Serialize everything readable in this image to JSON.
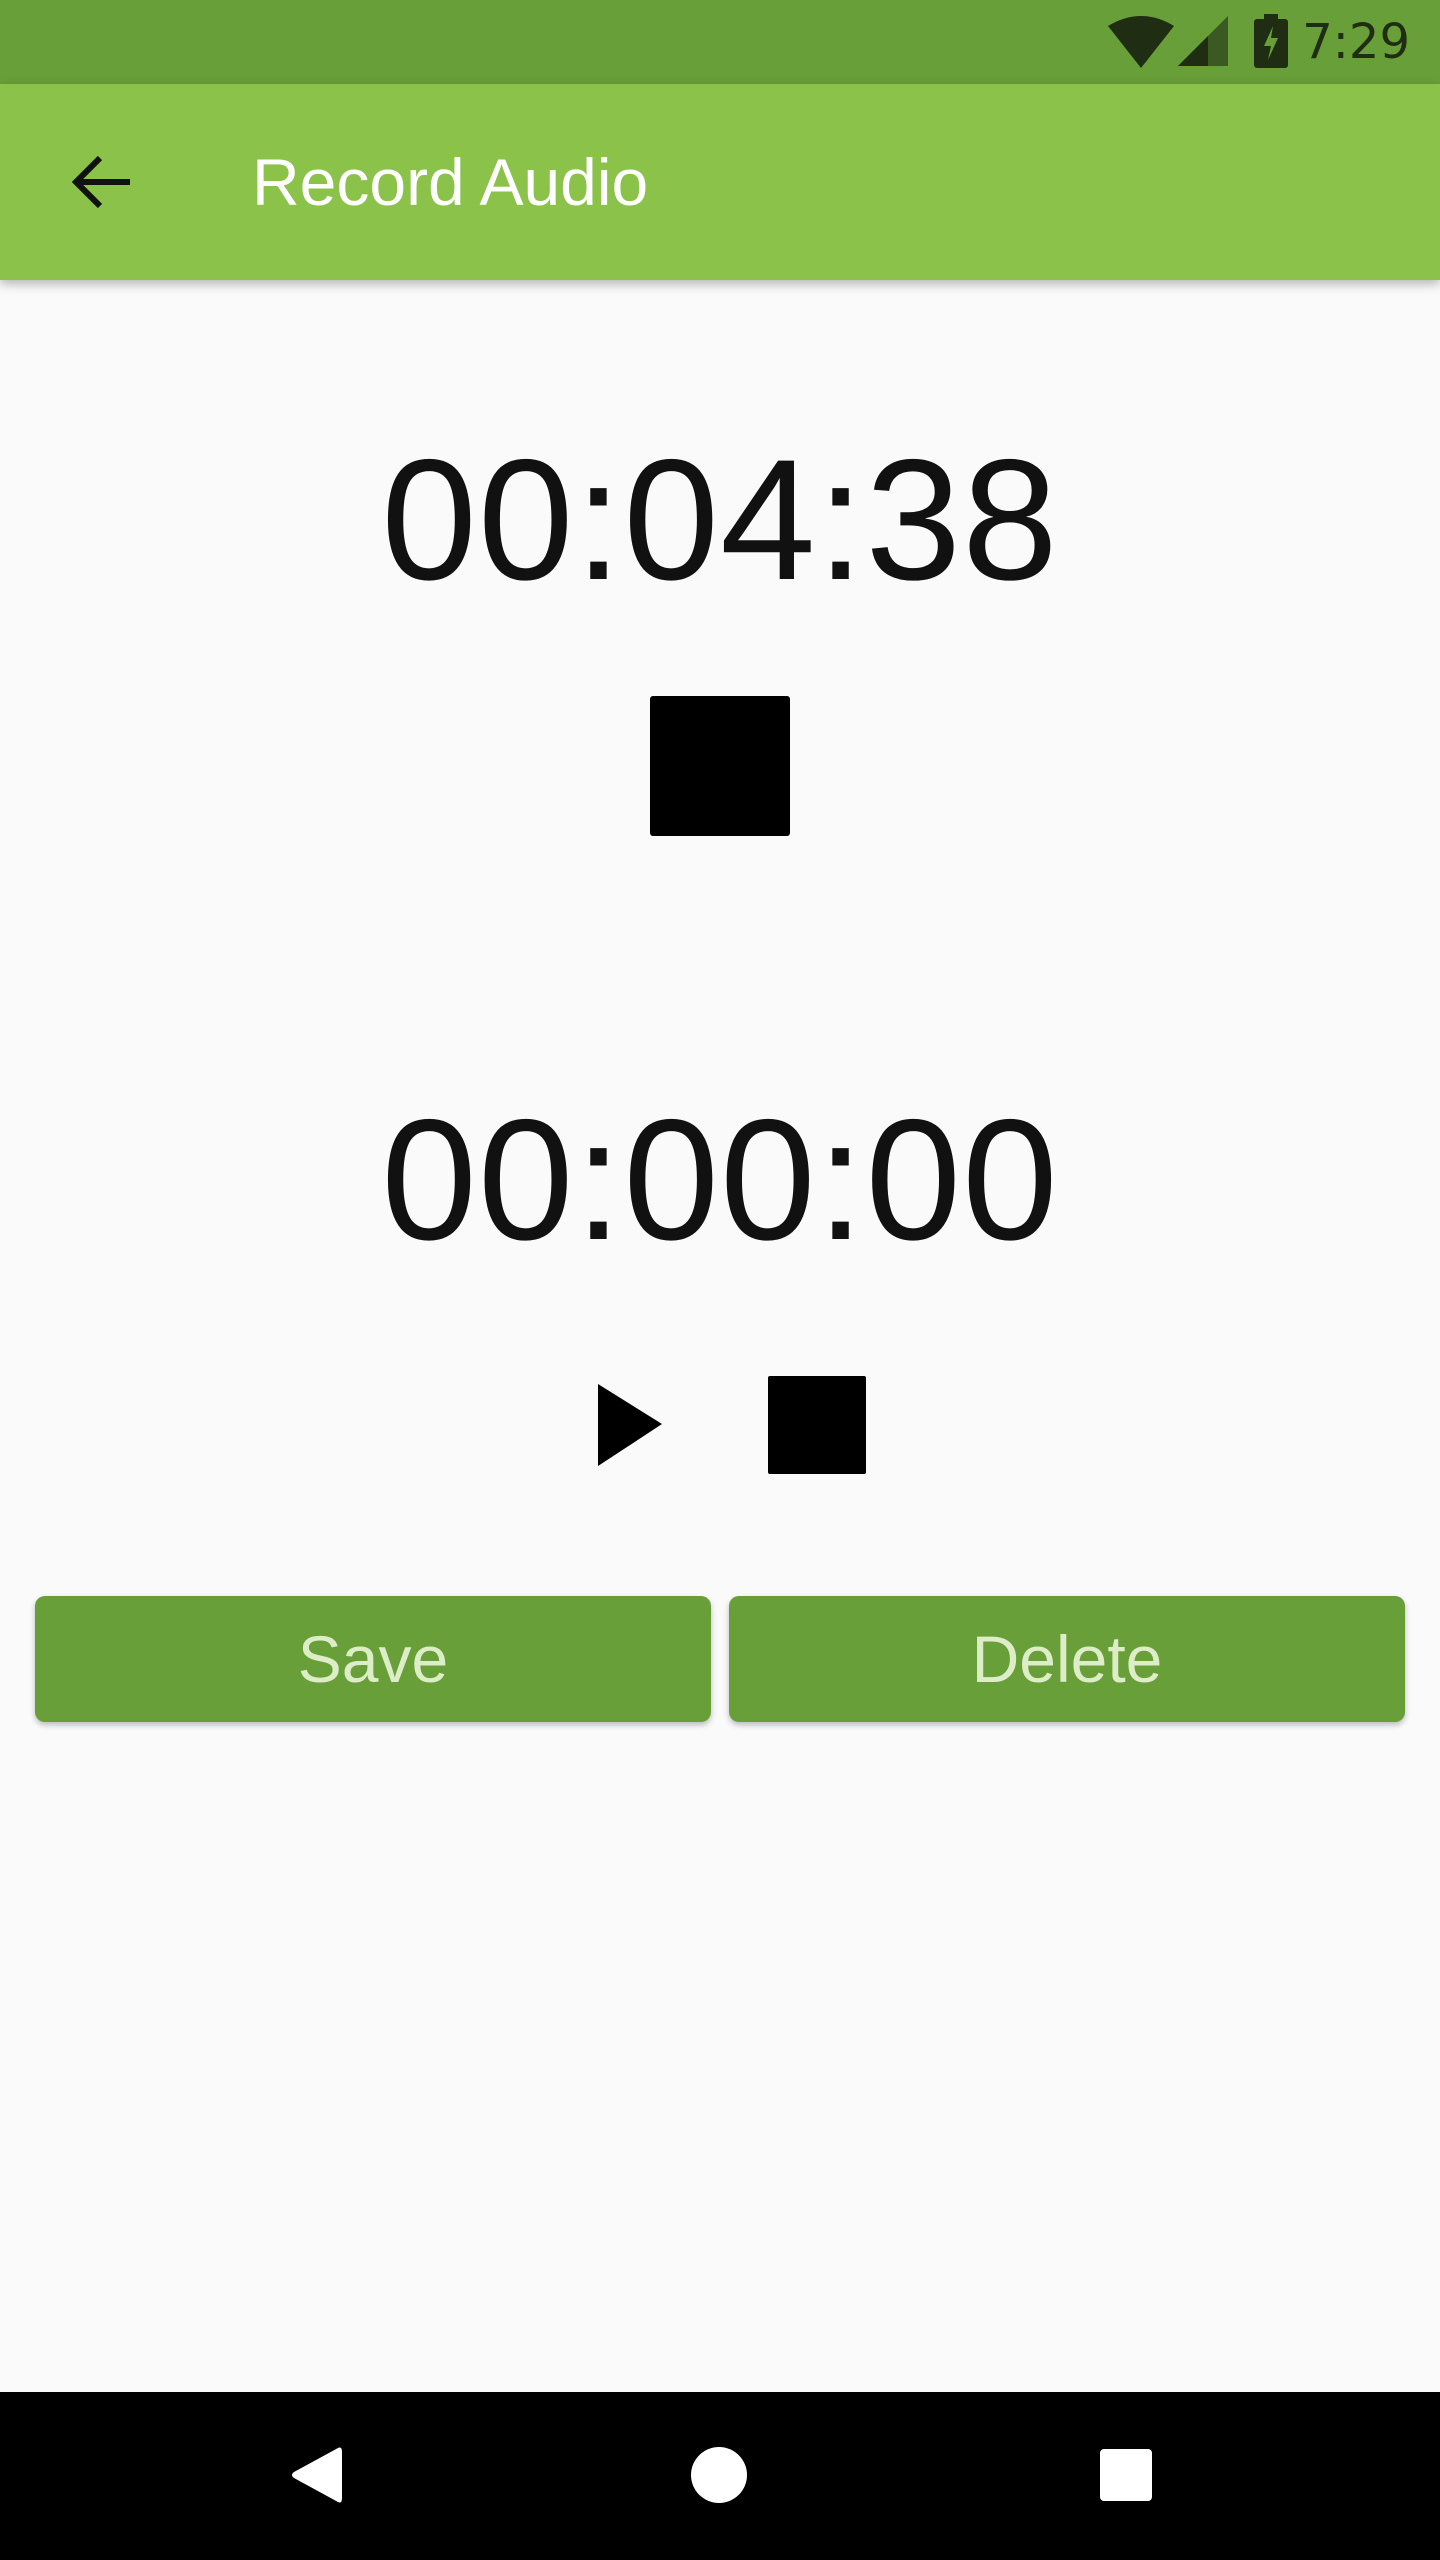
{
  "status_bar": {
    "time": "7:29",
    "icons": [
      "wifi-icon",
      "signal-icon",
      "battery-charging-icon"
    ]
  },
  "app_bar": {
    "title": "Record Audio",
    "back_icon": "arrow-back-icon"
  },
  "recorder": {
    "elapsed": "00:04:38",
    "stop_icon": "stop-icon"
  },
  "player": {
    "elapsed": "00:00:00",
    "play_icon": "play-icon",
    "stop_icon": "stop-icon"
  },
  "actions": {
    "save_label": "Save",
    "delete_label": "Delete"
  },
  "nav_bar": {
    "icons": [
      "nav-back-icon",
      "nav-home-icon",
      "nav-recents-icon"
    ]
  },
  "colors": {
    "status_bar": "#689f38",
    "app_bar": "#8bc34a",
    "button": "#689f38",
    "button_text": "#dcedc8",
    "background": "#fafafa"
  }
}
